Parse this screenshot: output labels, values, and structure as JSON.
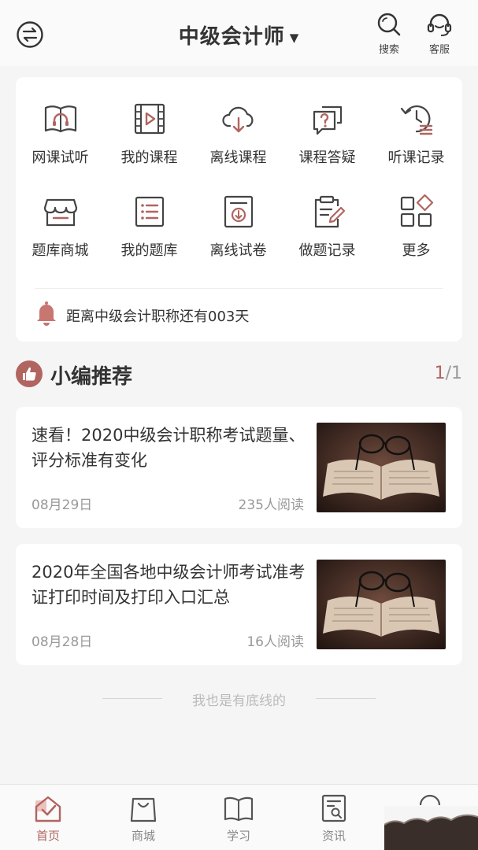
{
  "header": {
    "title": "中级会计师",
    "search_label": "搜索",
    "service_label": "客服"
  },
  "grid": [
    {
      "label": "网课试听",
      "icon": "book-headphone-icon"
    },
    {
      "label": "我的课程",
      "icon": "video-play-icon"
    },
    {
      "label": "离线课程",
      "icon": "cloud-download-icon"
    },
    {
      "label": "课程答疑",
      "icon": "question-chat-icon"
    },
    {
      "label": "听课记录",
      "icon": "history-icon"
    },
    {
      "label": "题库商城",
      "icon": "store-icon"
    },
    {
      "label": "我的题库",
      "icon": "list-icon"
    },
    {
      "label": "离线试卷",
      "icon": "paper-download-icon"
    },
    {
      "label": "做题记录",
      "icon": "clipboard-edit-icon"
    },
    {
      "label": "更多",
      "icon": "more-grid-icon"
    }
  ],
  "countdown": "距离中级会计职称还有003天",
  "section": {
    "title": "小编推荐",
    "page_current": "1",
    "page_total": "/1"
  },
  "articles": [
    {
      "title": "速看！2020中级会计职称考试题量、评分标准有变化",
      "date": "08月29日",
      "reads": "235人阅读"
    },
    {
      "title": "2020年全国各地中级会计师考试准考证打印时间及打印入口汇总",
      "date": "08月28日",
      "reads": "16人阅读"
    }
  ],
  "bottom_text": "我也是有底线的",
  "tabs": [
    {
      "label": "首页",
      "icon": "home-icon",
      "active": true
    },
    {
      "label": "商城",
      "icon": "shopping-bag-icon"
    },
    {
      "label": "学习",
      "icon": "open-book-icon"
    },
    {
      "label": "资讯",
      "icon": "news-icon"
    }
  ],
  "colors": {
    "accent": "#b06560",
    "icon_dark": "#444444"
  }
}
